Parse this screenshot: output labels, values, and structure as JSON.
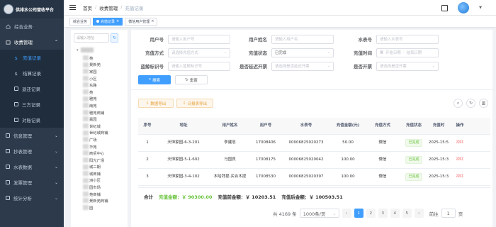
{
  "sidebar": {
    "title": "供排水公司营收平台",
    "items": [
      {
        "label": "综合业务"
      },
      {
        "label": "收费管理"
      },
      {
        "label": "信息管理"
      },
      {
        "label": "抄表管理"
      },
      {
        "label": "水表数据"
      },
      {
        "label": "发票管理"
      },
      {
        "label": "统计分析"
      }
    ],
    "sub_items": [
      {
        "label": "充值记录"
      },
      {
        "label": "结算记录"
      },
      {
        "label": "退还记录"
      },
      {
        "label": "三方记录"
      },
      {
        "label": "对账记录"
      }
    ]
  },
  "breadcrumb": [
    "首页",
    "收费管理",
    "充值记录"
  ],
  "tabs": [
    {
      "label": "综合业务"
    },
    {
      "label": "充值记录"
    },
    {
      "label": "微信用户管理"
    }
  ],
  "tree": {
    "search_placeholder": "请输入地址",
    "nodes": [
      "苑",
      "景新苑",
      "家园",
      "小区",
      "东路",
      "苑",
      "雅苑",
      "南苑",
      "雅苑商铺",
      "嘉园",
      "世纪城",
      "世纪城商铺",
      "广场",
      "华苑",
      "商贸中心",
      "阳光广场",
      "城二期",
      "城商铺",
      "洲小区",
      "园市场",
      "苑商铺",
      "景新苑商铺",
      "园"
    ]
  },
  "filters": {
    "user_no": {
      "label": "用户号",
      "placeholder": "请输入用户号"
    },
    "user_name": {
      "label": "用户姓名",
      "placeholder": "请输入用户名"
    },
    "meter_no": {
      "label": "水表号",
      "placeholder": "请输入水表号"
    },
    "pay_method": {
      "label": "充值方式",
      "placeholder": "请选择充值方式"
    },
    "pay_status": {
      "label": "充值状态",
      "value": "已完成"
    },
    "pay_time": {
      "label": "充值时间",
      "start": "开始日期",
      "sep": "-",
      "end": "结束日期"
    },
    "tag_no": {
      "label": "蓝鲸标识号",
      "placeholder": "请输入蓝鲸标识号"
    },
    "delay_invoice": {
      "label": "是否延迟开票",
      "placeholder": "请选择是否延迟开票"
    },
    "invoiced": {
      "label": "是否开票",
      "placeholder": "请选择是否开票"
    }
  },
  "buttons": {
    "search": "搜索",
    "reset": "重置",
    "export_data": "数据导出",
    "export_daily": "日报表导出"
  },
  "table": {
    "headers": [
      "序号",
      "地址",
      "用户姓名",
      "用户号",
      "水表号",
      "充值金额(元)",
      "充值方式",
      "充值状态",
      "充值时",
      "操作"
    ],
    "rows": [
      {
        "index": "1",
        "address": "天恒家园-6-3-201",
        "name": "李建忠",
        "user_no": "17008406",
        "meter_no": "00006825020273",
        "amount": "50.00",
        "method": "微信",
        "status": "已完成",
        "time": "2025-15:5",
        "op": "冲红"
      },
      {
        "index": "2",
        "address": "天恒家园-5-1-602",
        "name": "马国良",
        "user_no": "17008175",
        "meter_no": "00006825020042",
        "amount": "100.00",
        "method": "微信",
        "status": "已完成",
        "time": "2025-15:3",
        "op": "冲红"
      },
      {
        "index": "3",
        "address": "天恒家园-3-4-102",
        "name": "木哈拜提·买合木提",
        "user_no": "17008530",
        "meter_no": "00006825020397",
        "amount": "100.00",
        "method": "微信",
        "status": "已完成",
        "time": "2025-15:3",
        "op": "冲红"
      }
    ]
  },
  "summary": {
    "label": "合计",
    "total": "充值金额：￥ 90300.00",
    "before": "充值前金额：￥ 10203.51",
    "after": "充值后金额：￥ 100503.51"
  },
  "pagination": {
    "total": "共 4169 条",
    "page_size": "1000条/页",
    "pages": [
      "1",
      "2",
      "3",
      "4",
      "5"
    ],
    "current": "1",
    "goto_label": "前往",
    "goto_value": "1",
    "goto_suffix": "页"
  },
  "colors": {
    "primary": "#409eff",
    "sidebar": "#2d3a4b",
    "success": "#67c23a",
    "danger": "#f56c6c",
    "warning": "#e6a23c"
  }
}
